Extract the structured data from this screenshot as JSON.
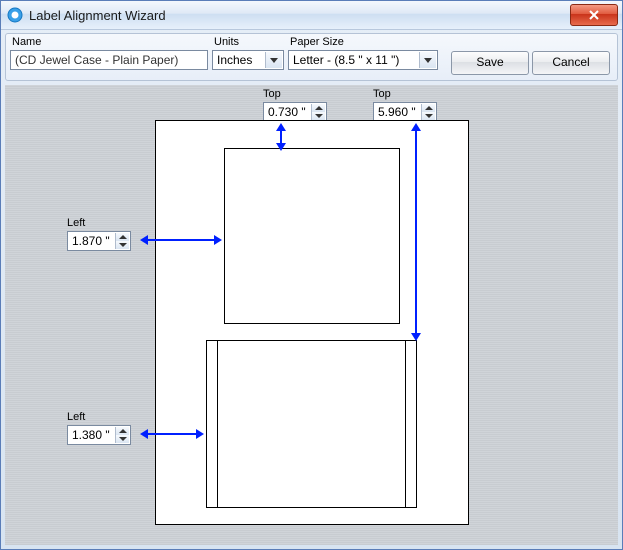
{
  "window": {
    "title": "Label Alignment Wizard"
  },
  "toolbar": {
    "name_label": "Name",
    "name_value": "(CD Jewel Case - Plain Paper)",
    "units_label": "Units",
    "units_value": "Inches",
    "paper_label": "Paper Size",
    "paper_value": "Letter - (8.5 \" x 11 \")",
    "save_label": "Save",
    "cancel_label": "Cancel"
  },
  "measurements": {
    "top1_label": "Top",
    "top1_value": "0.730 \"",
    "top2_label": "Top",
    "top2_value": "5.960 \"",
    "left1_label": "Left",
    "left1_value": "1.870 \"",
    "left2_label": "Left",
    "left2_value": "1.380 \""
  }
}
